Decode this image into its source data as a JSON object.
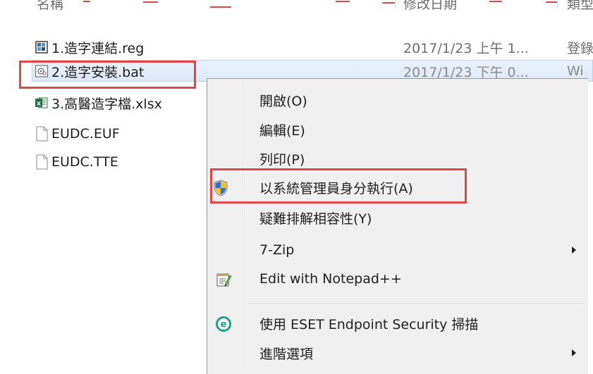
{
  "header": {
    "name_col": "名稱",
    "date_col": "修改日期",
    "type_col": "類型"
  },
  "files": [
    {
      "name": "1.造字連結.reg",
      "date": "2017/1/23 上午 1...",
      "type": "登錄",
      "icon": "registry-file-icon"
    },
    {
      "name": "2.造字安裝.bat",
      "date": "2017/1/23 下午 0...",
      "type": "Wi",
      "icon": "batch-file-icon"
    },
    {
      "name": "3.高醫造字檔.xlsx",
      "date": "",
      "type": "",
      "icon": "excel-file-icon"
    },
    {
      "name": "EUDC.EUF",
      "date": "",
      "type": "",
      "icon": "blank-file-icon"
    },
    {
      "name": "EUDC.TTE",
      "date": "",
      "type": "",
      "icon": "blank-file-icon"
    }
  ],
  "context_menu": {
    "items": [
      {
        "label": "開啟(O)",
        "icon": "",
        "submenu": false
      },
      {
        "label": "編輯(E)",
        "icon": "",
        "submenu": false
      },
      {
        "label": "列印(P)",
        "icon": "",
        "submenu": false
      },
      {
        "label": "以系統管理員身分執行(A)",
        "icon": "uac-shield-icon",
        "submenu": false
      },
      {
        "label": "疑難排解相容性(Y)",
        "icon": "",
        "submenu": false
      },
      {
        "label": "7-Zip",
        "icon": "",
        "submenu": true
      },
      {
        "label": "Edit with Notepad++",
        "icon": "notepad-plus-plus-icon",
        "submenu": false
      },
      {
        "label": "使用 ESET Endpoint Security 掃描",
        "icon": "eset-icon",
        "submenu": false
      },
      {
        "label": "進階選項",
        "icon": "",
        "submenu": true
      }
    ]
  },
  "colors": {
    "highlight_red": "#e0454a",
    "selection_blue": "#dce9f7",
    "menu_bg": "#f0f0f0",
    "eset_green": "#1aa58a"
  }
}
